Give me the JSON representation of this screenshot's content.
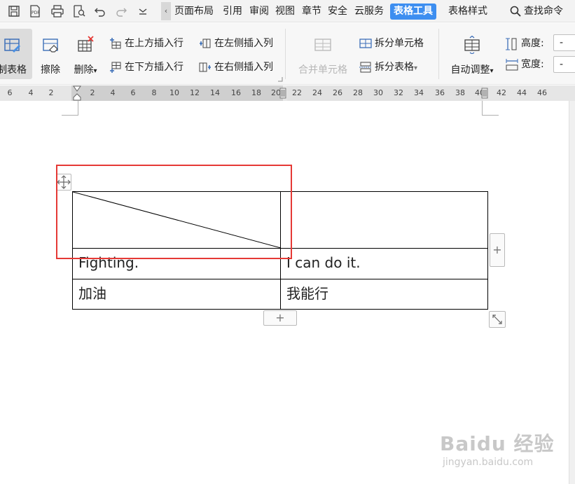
{
  "menubar": {
    "scroll_left_glyph": "‹",
    "tabs": [
      "页面布局",
      "引用",
      "审阅",
      "视图",
      "章节",
      "安全",
      "云服务",
      "表格工具",
      "表格样式"
    ],
    "search_label": "查找命令"
  },
  "ribbon": {
    "draw_table": "制表格",
    "eraser": "擦除",
    "delete": "删除",
    "insert_row_above": "在上方插入行",
    "insert_row_below": "在下方插入行",
    "insert_col_left": "在左侧插入列",
    "insert_col_right": "在右侧插入列",
    "merge_cells": "合并单元格",
    "split_cells": "拆分单元格",
    "split_table": "拆分表格",
    "auto_adjust": "自动调整",
    "height_label": "高度:",
    "width_label": "宽度:",
    "height_value": "-",
    "width_value": "-",
    "dropdown_glyph": "▾"
  },
  "ruler": {
    "ticks": [
      "6",
      "4",
      "2",
      "2",
      "4",
      "6",
      "8",
      "10",
      "12",
      "14",
      "16",
      "18",
      "20",
      "22",
      "24",
      "26",
      "28",
      "30",
      "32",
      "34",
      "36",
      "38",
      "40",
      "42",
      "44",
      "46"
    ]
  },
  "table": {
    "rows": [
      [
        "",
        ""
      ],
      [
        "Fighting.",
        "I can do it."
      ],
      [
        "加油",
        "我能行"
      ]
    ],
    "add_glyph": "+"
  },
  "watermark": {
    "logo": "Baidu 经验",
    "url": "jingyan.baidu.com"
  }
}
